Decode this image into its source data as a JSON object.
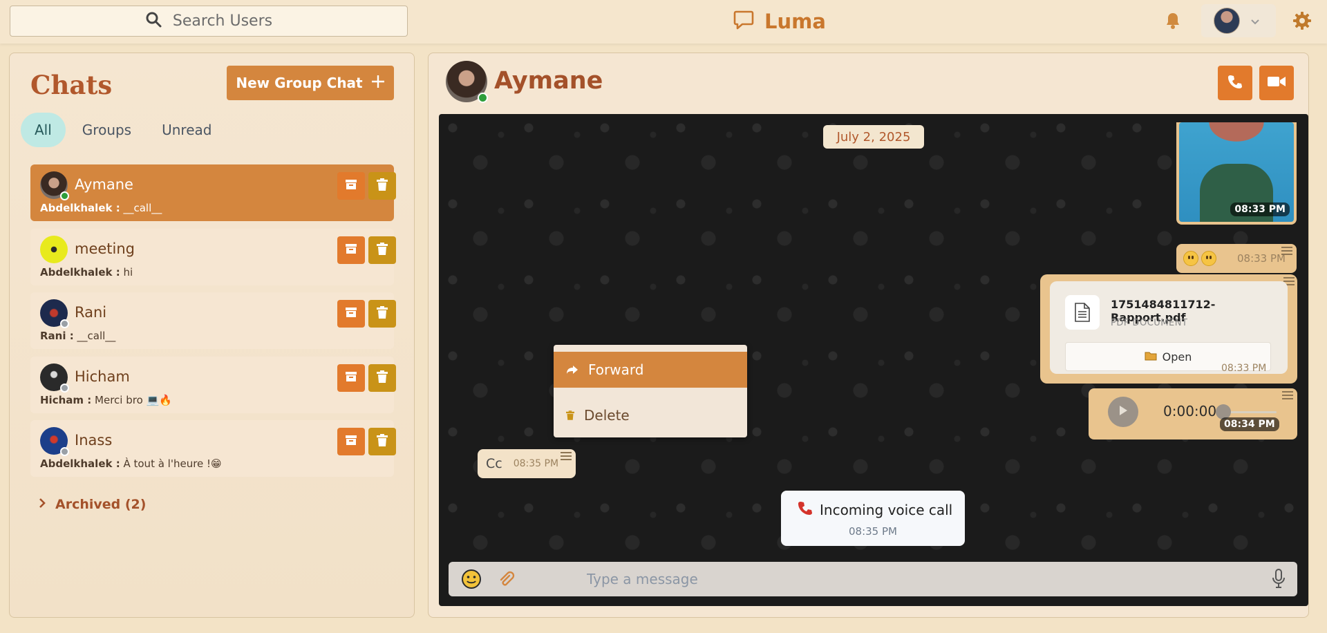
{
  "header": {
    "search_placeholder": "Search Users",
    "brand": "Luma"
  },
  "sidebar": {
    "title": "Chats",
    "new_group_label": "New Group Chat",
    "tabs": [
      {
        "label": "All",
        "active": true
      },
      {
        "label": "Groups",
        "active": false
      },
      {
        "label": "Unread",
        "active": false
      }
    ],
    "chats": [
      {
        "name": "Aymane",
        "sender": "Abdelkhalek :",
        "preview": "__call__",
        "active": true,
        "online": true
      },
      {
        "name": "meeting",
        "sender": "Abdelkhalek :",
        "preview": "hi",
        "active": false,
        "online": false
      },
      {
        "name": "Rani",
        "sender": "Rani :",
        "preview": "__call__",
        "active": false,
        "online": false
      },
      {
        "name": "Hicham",
        "sender": "Hicham :",
        "preview": "Merci bro 💻🔥",
        "active": false,
        "online": false
      },
      {
        "name": "Inass",
        "sender": "Abdelkhalek :",
        "preview": "À tout à l'heure !😁",
        "active": false,
        "online": false
      }
    ],
    "archived_label": "Archived (2)"
  },
  "conversation": {
    "contact_name": "Aymane",
    "date_label": "July 2, 2025",
    "messages": {
      "image_time": "08:33 PM",
      "emoji_text": "😀😀",
      "emoji_time": "08:33 PM",
      "file_name": "1751484811712-Rapport.pdf",
      "file_type": "PDF DOCUMENT",
      "file_open_label": "Open",
      "file_time": "08:33 PM",
      "audio_position": "0:00:00",
      "audio_time": "08:34 PM",
      "cc_text": "Cc",
      "cc_time": "08:35 PM",
      "call_title": "Incoming voice call",
      "call_time": "08:35 PM"
    },
    "context_menu": {
      "forward_label": "Forward",
      "delete_label": "Delete"
    },
    "composer_placeholder": "Type a message"
  },
  "colors": {
    "accent": "#d4863e",
    "archive_button": "#e27a2c",
    "delete_button": "#c99318",
    "title": "#b1582c"
  }
}
